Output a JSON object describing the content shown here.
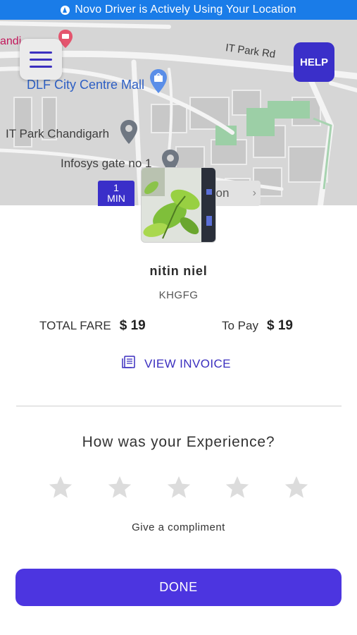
{
  "status_bar": {
    "text": "Novo Driver is Actively Using Your Location",
    "color": "#1a7ce8"
  },
  "map": {
    "labels": {
      "partial_place": "andi",
      "road": "IT Park Rd",
      "mall": "DLF City Centre Mall",
      "it_park": "IT Park Chandigarh",
      "infosys": "Infosys gate no 1"
    },
    "eta_badge": {
      "value": "1",
      "unit": "MIN"
    },
    "destination_chip": "tion"
  },
  "header": {
    "menu_icon": "hamburger-menu-icon",
    "help_label": "HELP"
  },
  "driver": {
    "name": "nitin niel",
    "vehicle": "KHGFG"
  },
  "fare": {
    "total_label": "TOTAL FARE",
    "total_amount": "$ 19",
    "to_pay_label": "To Pay",
    "to_pay_amount": "$ 19"
  },
  "invoice": {
    "label": "VIEW INVOICE",
    "icon": "document-icon"
  },
  "rating": {
    "title": "How was your Experience?",
    "max_stars": 5,
    "selected_stars": 0,
    "compliment_label": "Give a compliment"
  },
  "done_button": {
    "label": "DONE",
    "color": "#4c35e0"
  },
  "colors": {
    "accent": "#3b2fbf",
    "star_inactive": "#dcdcdc"
  }
}
